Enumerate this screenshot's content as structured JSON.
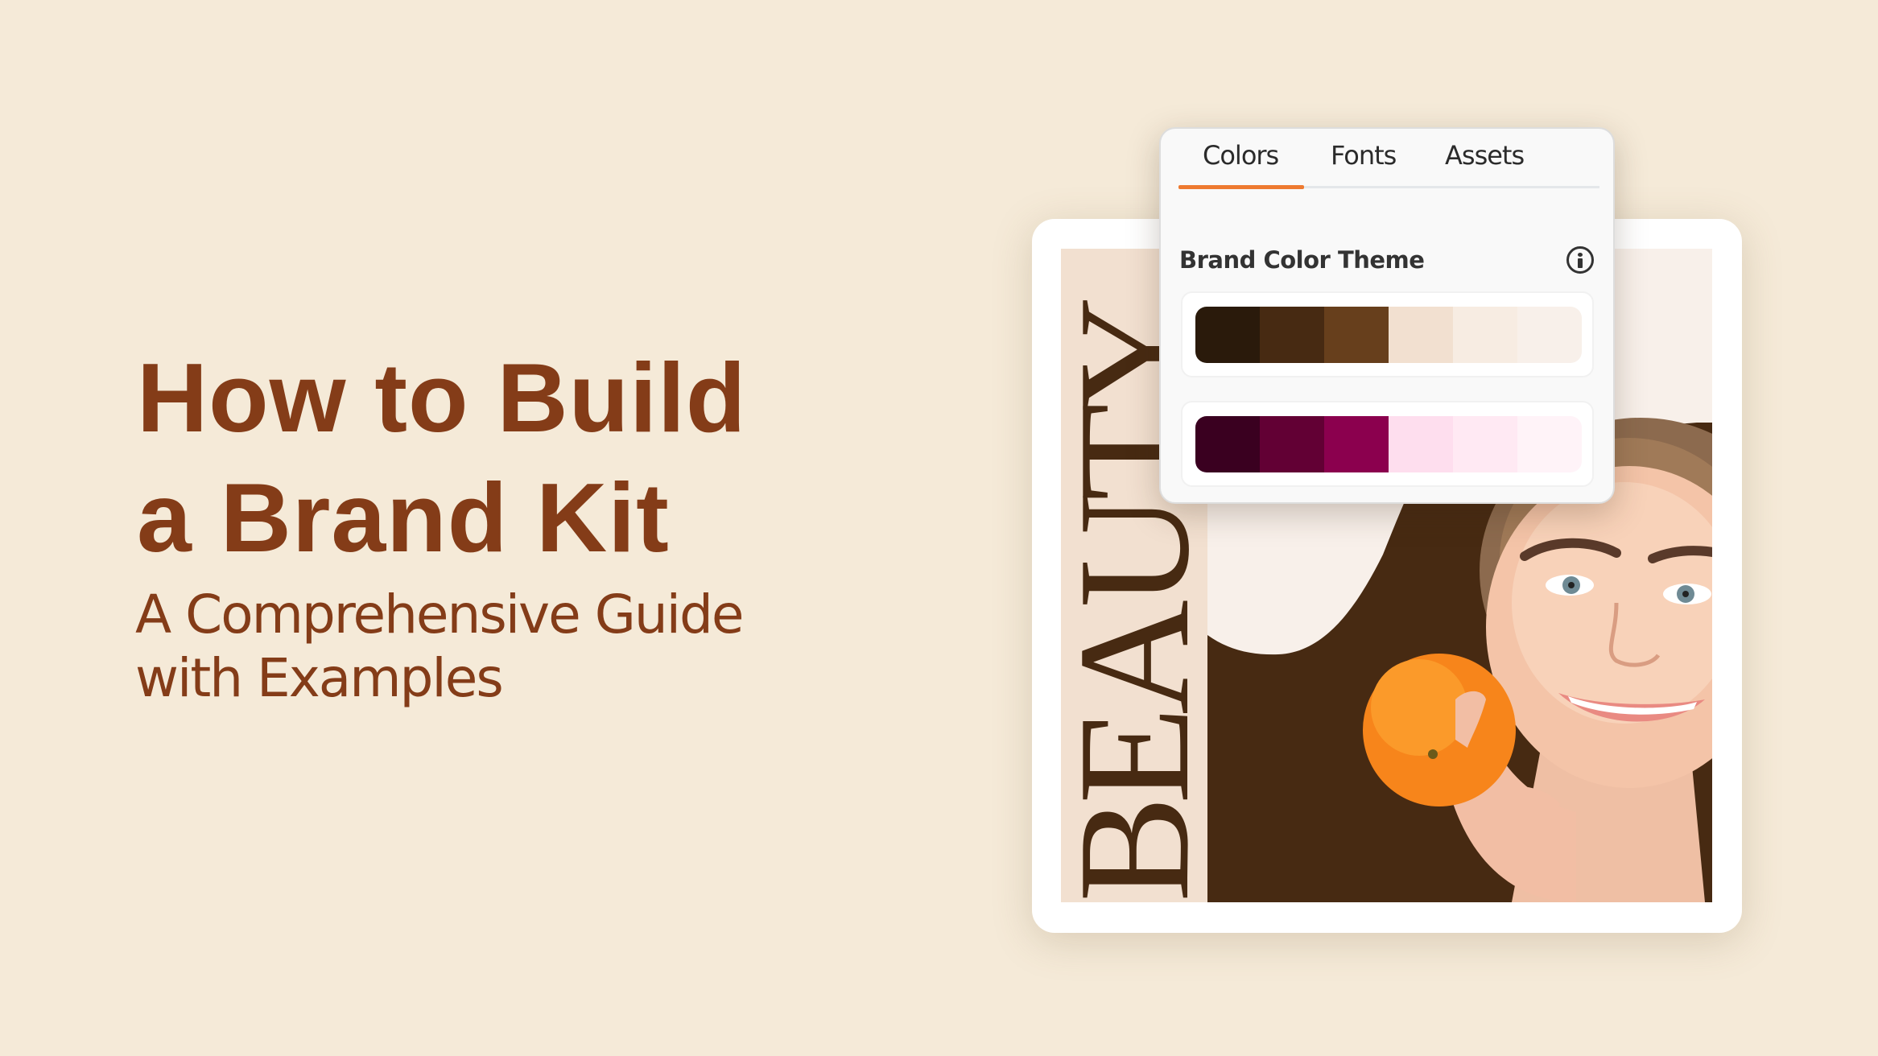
{
  "hero": {
    "title_line1": "How to Build",
    "title_line2": "a Brand Kit",
    "subtitle_line1": "A Comprehensive Guide",
    "subtitle_line2": "with Examples"
  },
  "design_preview": {
    "vertical_text": "BEAUTY",
    "colors": {
      "strip": "#f2e0d0",
      "background": "#f8f0ea",
      "brown": "#472a12",
      "orange": "#f7851b"
    }
  },
  "brand_panel": {
    "tabs": [
      {
        "label": "Colors",
        "active": true
      },
      {
        "label": "Fonts",
        "active": false
      },
      {
        "label": "Assets",
        "active": false
      }
    ],
    "accent_color": "#ee7a30",
    "section_title": "Brand Color Theme",
    "info_icon": "info-icon",
    "palettes": [
      {
        "name": "brown-palette",
        "colors": [
          "#2a1a0b",
          "#472a12",
          "#673f1c",
          "#f2e0d0",
          "#f7ece2",
          "#f8f0ea"
        ]
      },
      {
        "name": "magenta-palette",
        "colors": [
          "#3a0020",
          "#620034",
          "#8b004e",
          "#fedeee",
          "#ffe9f3",
          "#fff3f8"
        ]
      }
    ]
  }
}
